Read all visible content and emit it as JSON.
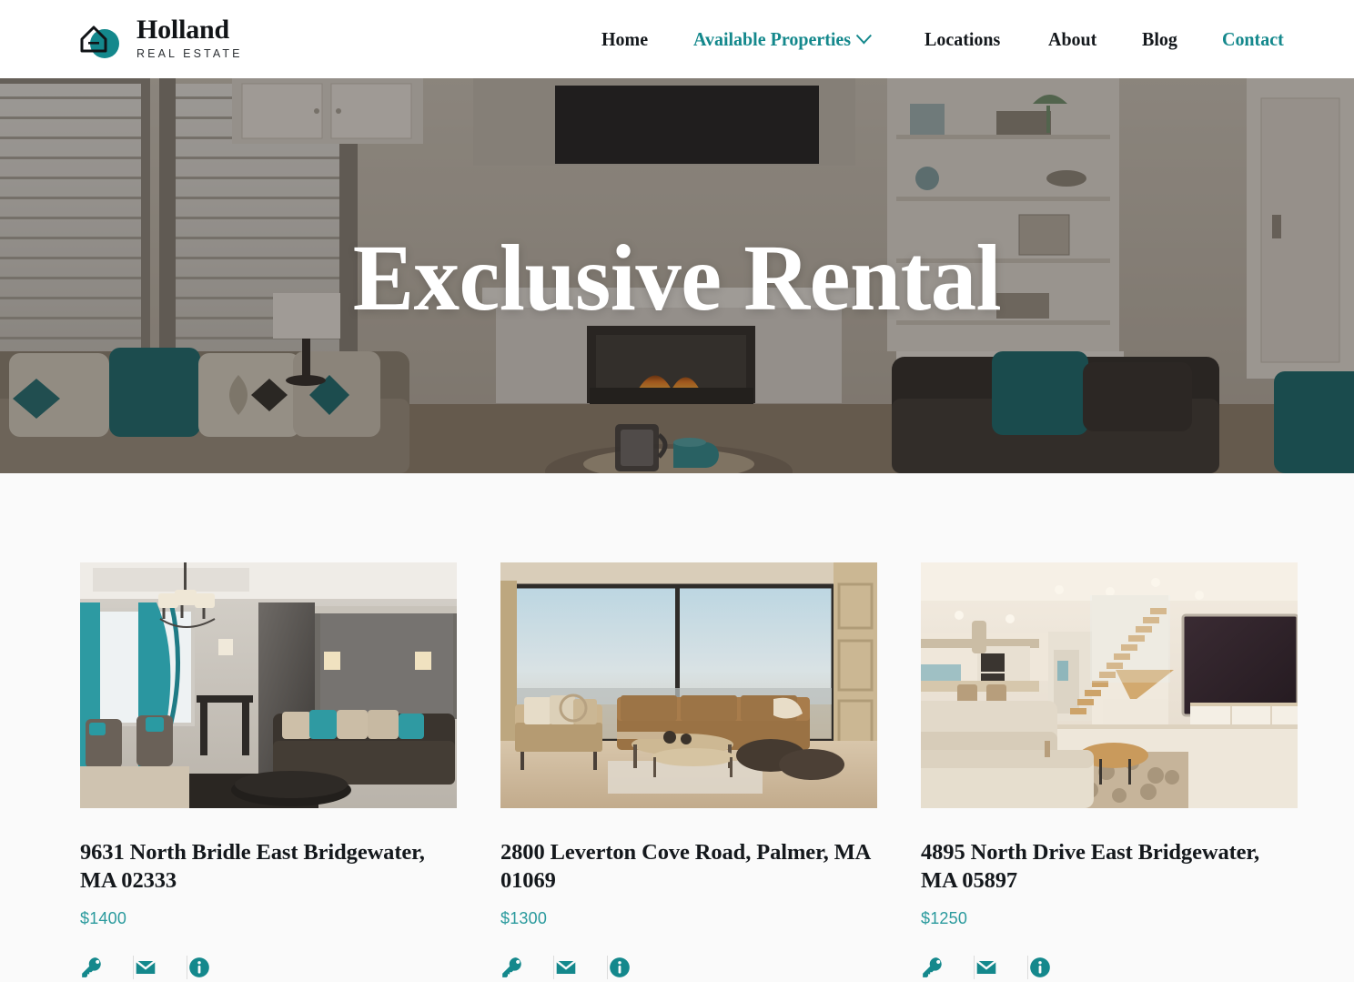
{
  "brand": {
    "name": "Holland",
    "tagline": "REAL ESTATE",
    "logo_icon": "house-in-circle-icon",
    "accent_color": "#14888c"
  },
  "nav": {
    "items": [
      {
        "label": "Home",
        "active": false,
        "has_dropdown": false
      },
      {
        "label": "Available Properties",
        "active": true,
        "has_dropdown": true,
        "dropdown_icon": "chevron-down-icon"
      },
      {
        "label": "Locations",
        "active": false,
        "has_dropdown": false
      },
      {
        "label": "About",
        "active": false,
        "has_dropdown": false
      },
      {
        "label": "Blog",
        "active": false,
        "has_dropdown": false
      },
      {
        "label": "Contact",
        "active": true,
        "has_dropdown": false
      }
    ]
  },
  "hero": {
    "title": "Exclusive Rental",
    "image_alt": "living-room-with-fireplace-and-teal-pillows"
  },
  "listings": {
    "cards": [
      {
        "title": "9631 North Bridle East Bridgewater, MA 02333",
        "price": "$1400",
        "image_alt": "elegant-living-room-teal-curtains-chandelier",
        "actions": [
          {
            "icon": "key-icon",
            "label": "Rent"
          },
          {
            "icon": "envelope-icon",
            "label": "Contact"
          },
          {
            "icon": "info-circle-icon",
            "label": "Details"
          }
        ]
      },
      {
        "title": "2800 Leverton Cove Road, Palmer, MA 01069",
        "price": "$1300",
        "image_alt": "modern-living-room-panoramic-window-view",
        "actions": [
          {
            "icon": "key-icon",
            "label": "Rent"
          },
          {
            "icon": "envelope-icon",
            "label": "Contact"
          },
          {
            "icon": "info-circle-icon",
            "label": "Details"
          }
        ]
      },
      {
        "title": "4895 North Drive East Bridgewater, MA 05897",
        "price": "$1250",
        "image_alt": "bright-modern-interior-staircase-and-tv",
        "actions": [
          {
            "icon": "key-icon",
            "label": "Rent"
          },
          {
            "icon": "envelope-icon",
            "label": "Contact"
          },
          {
            "icon": "info-circle-icon",
            "label": "Details"
          }
        ]
      }
    ]
  },
  "colors": {
    "accent": "#14888c",
    "price": "#2a9a9d",
    "text": "#14181c",
    "page_bg": "#fafafa",
    "header_bg": "#ffffff"
  }
}
